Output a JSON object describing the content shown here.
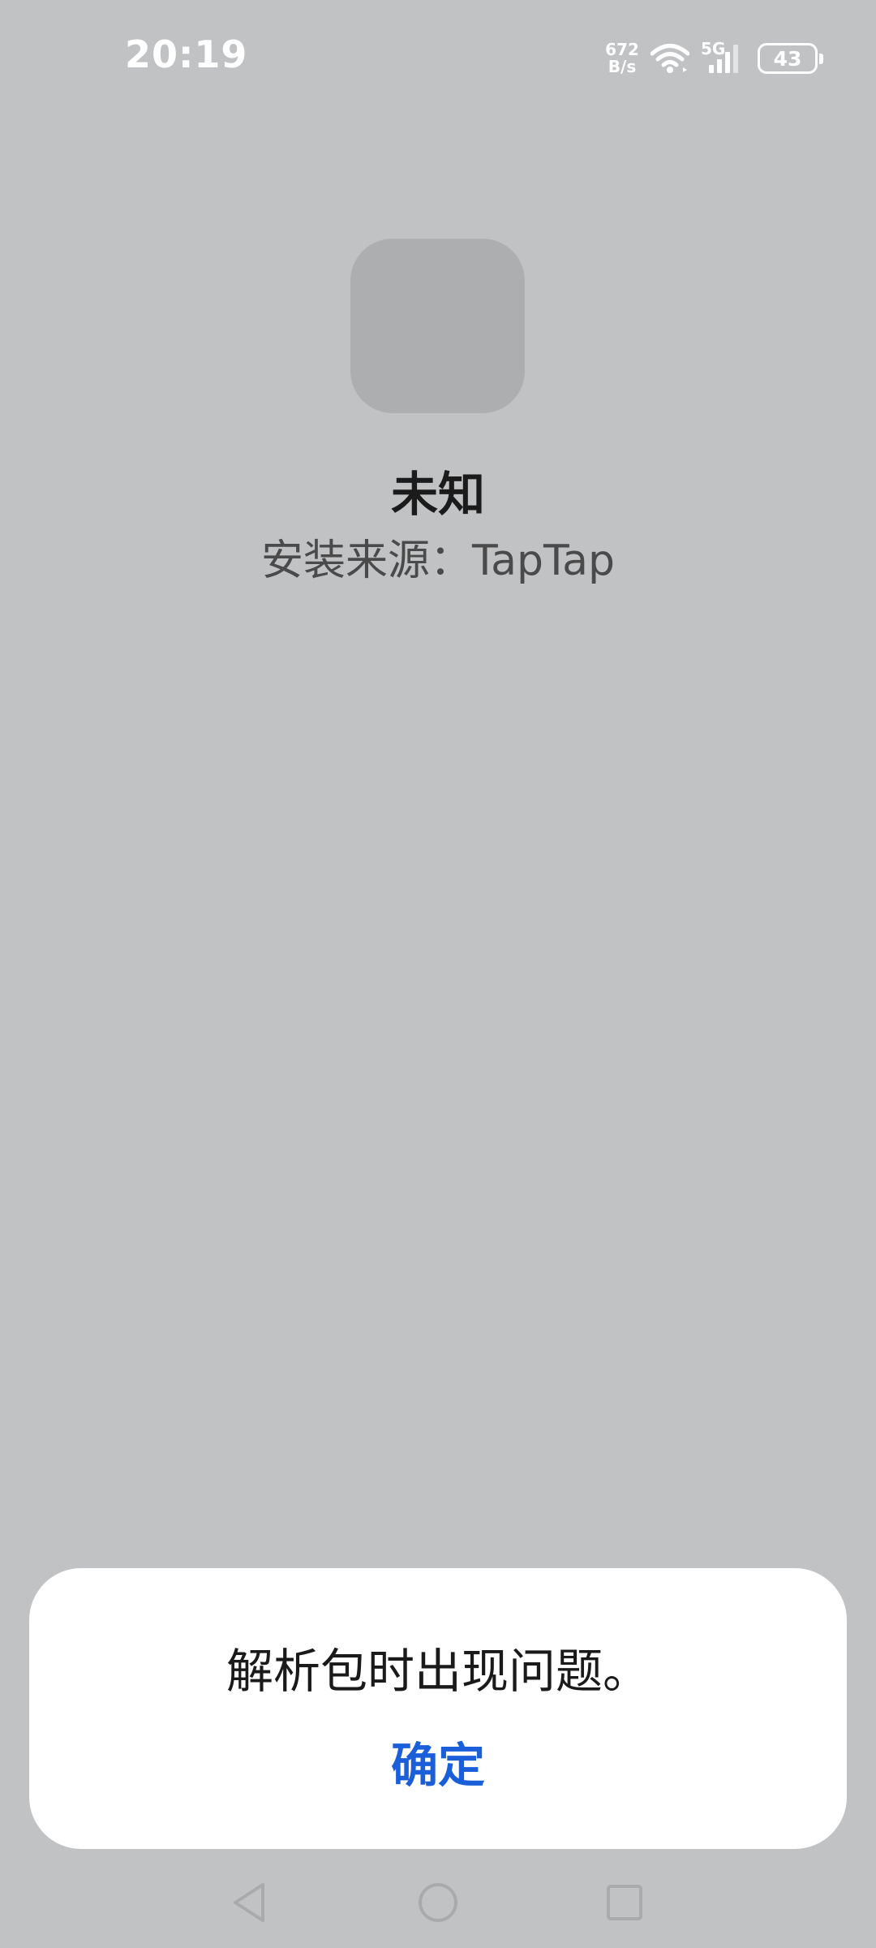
{
  "status_bar": {
    "time": "20:19",
    "net_speed_value": "672",
    "net_speed_unit": "B/s",
    "network_type": "5G",
    "battery_level": "43",
    "icons": [
      "wifi-icon",
      "signal-icon",
      "battery-icon"
    ]
  },
  "app": {
    "name": "未知",
    "install_source": "安装来源：TapTap"
  },
  "dialog": {
    "message": "解析包时出现问题。",
    "confirm_label": "确定",
    "accent_color": "#1a5fd9"
  },
  "nav_bar": {
    "icons": [
      "back-icon",
      "home-icon",
      "recents-icon"
    ]
  }
}
